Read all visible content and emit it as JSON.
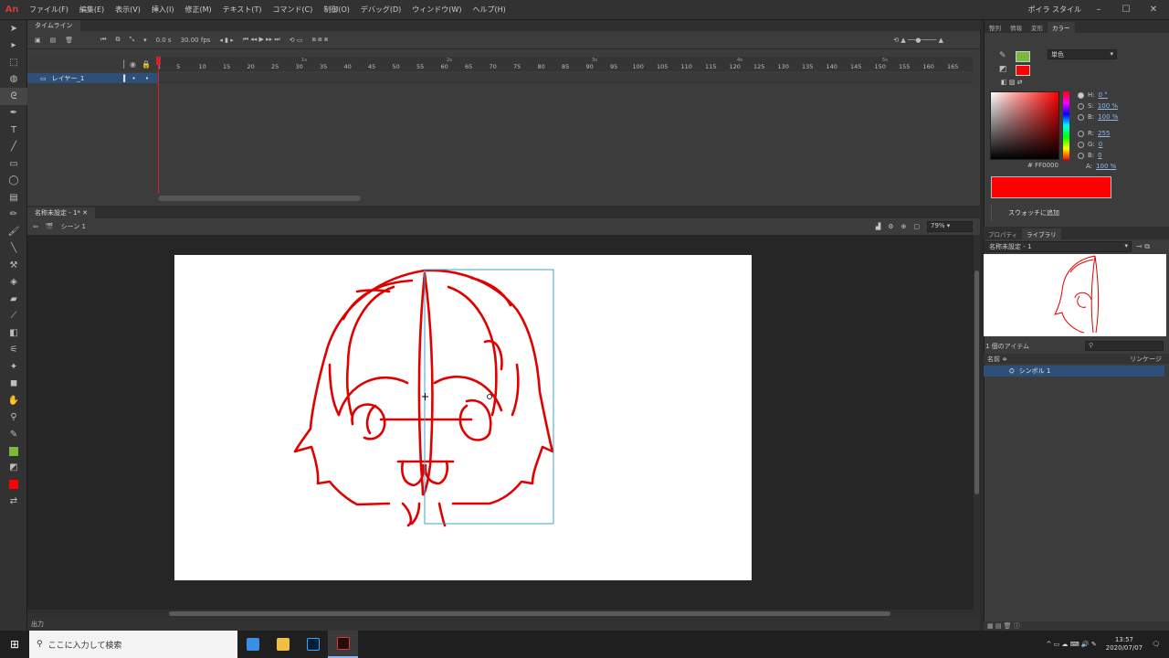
{
  "app": {
    "logo": "An",
    "menu": [
      "ファイル(F)",
      "編集(E)",
      "表示(V)",
      "挿入(I)",
      "修正(M)",
      "テキスト(T)",
      "コマンド(C)",
      "制御(O)",
      "デバッグ(D)",
      "ウィンドウ(W)",
      "ヘルプ(H)"
    ],
    "workspace": "ポイラ スタイル",
    "accent_red": "#ff0000",
    "accent_green": "#7cb83a"
  },
  "timeline": {
    "tab_label": "タイムライン",
    "frame_value": "0.0 s",
    "fps_value": "30.00 fps",
    "layer_name": "レイヤー_1",
    "frame_numbers": [
      "1",
      "5",
      "10",
      "15",
      "20",
      "25",
      "30",
      "35",
      "40",
      "45",
      "50",
      "55",
      "60",
      "65",
      "70",
      "75",
      "80",
      "85",
      "90",
      "95",
      "100",
      "105",
      "110",
      "115",
      "120",
      "125",
      "130",
      "135",
      "140",
      "145",
      "150",
      "155",
      "160",
      "165"
    ],
    "second_marks": [
      "1s",
      "2s",
      "3s",
      "4s",
      "5s"
    ]
  },
  "document": {
    "tab_label": "名称未設定 - 1*",
    "scene_label": "シーン 1",
    "zoom": "79%"
  },
  "right_panel": {
    "top_tabs": [
      "整列",
      "情報",
      "変形",
      "カラー"
    ],
    "color_mode": "単色",
    "fields": [
      {
        "label": "H:",
        "value": "0 °",
        "on": true
      },
      {
        "label": "S:",
        "value": "100 %",
        "on": false
      },
      {
        "label": "B:",
        "value": "100 %",
        "on": false
      },
      {
        "label": "R:",
        "value": "255",
        "on": false
      },
      {
        "label": "G:",
        "value": "0",
        "on": false
      },
      {
        "label": "B:",
        "value": "0",
        "on": false
      }
    ],
    "alpha_label": "A:",
    "alpha_value": "100 %",
    "hex_value": "FF0000",
    "add_swatch_label": "スウォッチに追加",
    "lib_tabs": [
      "プロパティ",
      "ライブラリ"
    ],
    "lib_doc": "名称未設定 - 1",
    "lib_count": "1 個のアイテム",
    "lib_col_name": "名前 ≑",
    "lib_col_link": "リンケージ",
    "lib_item": "シンボル 1",
    "output_label": "出力"
  },
  "taskbar": {
    "search_placeholder": "ここに入力して検索",
    "time": "13:57",
    "date": "2020/07/07"
  }
}
